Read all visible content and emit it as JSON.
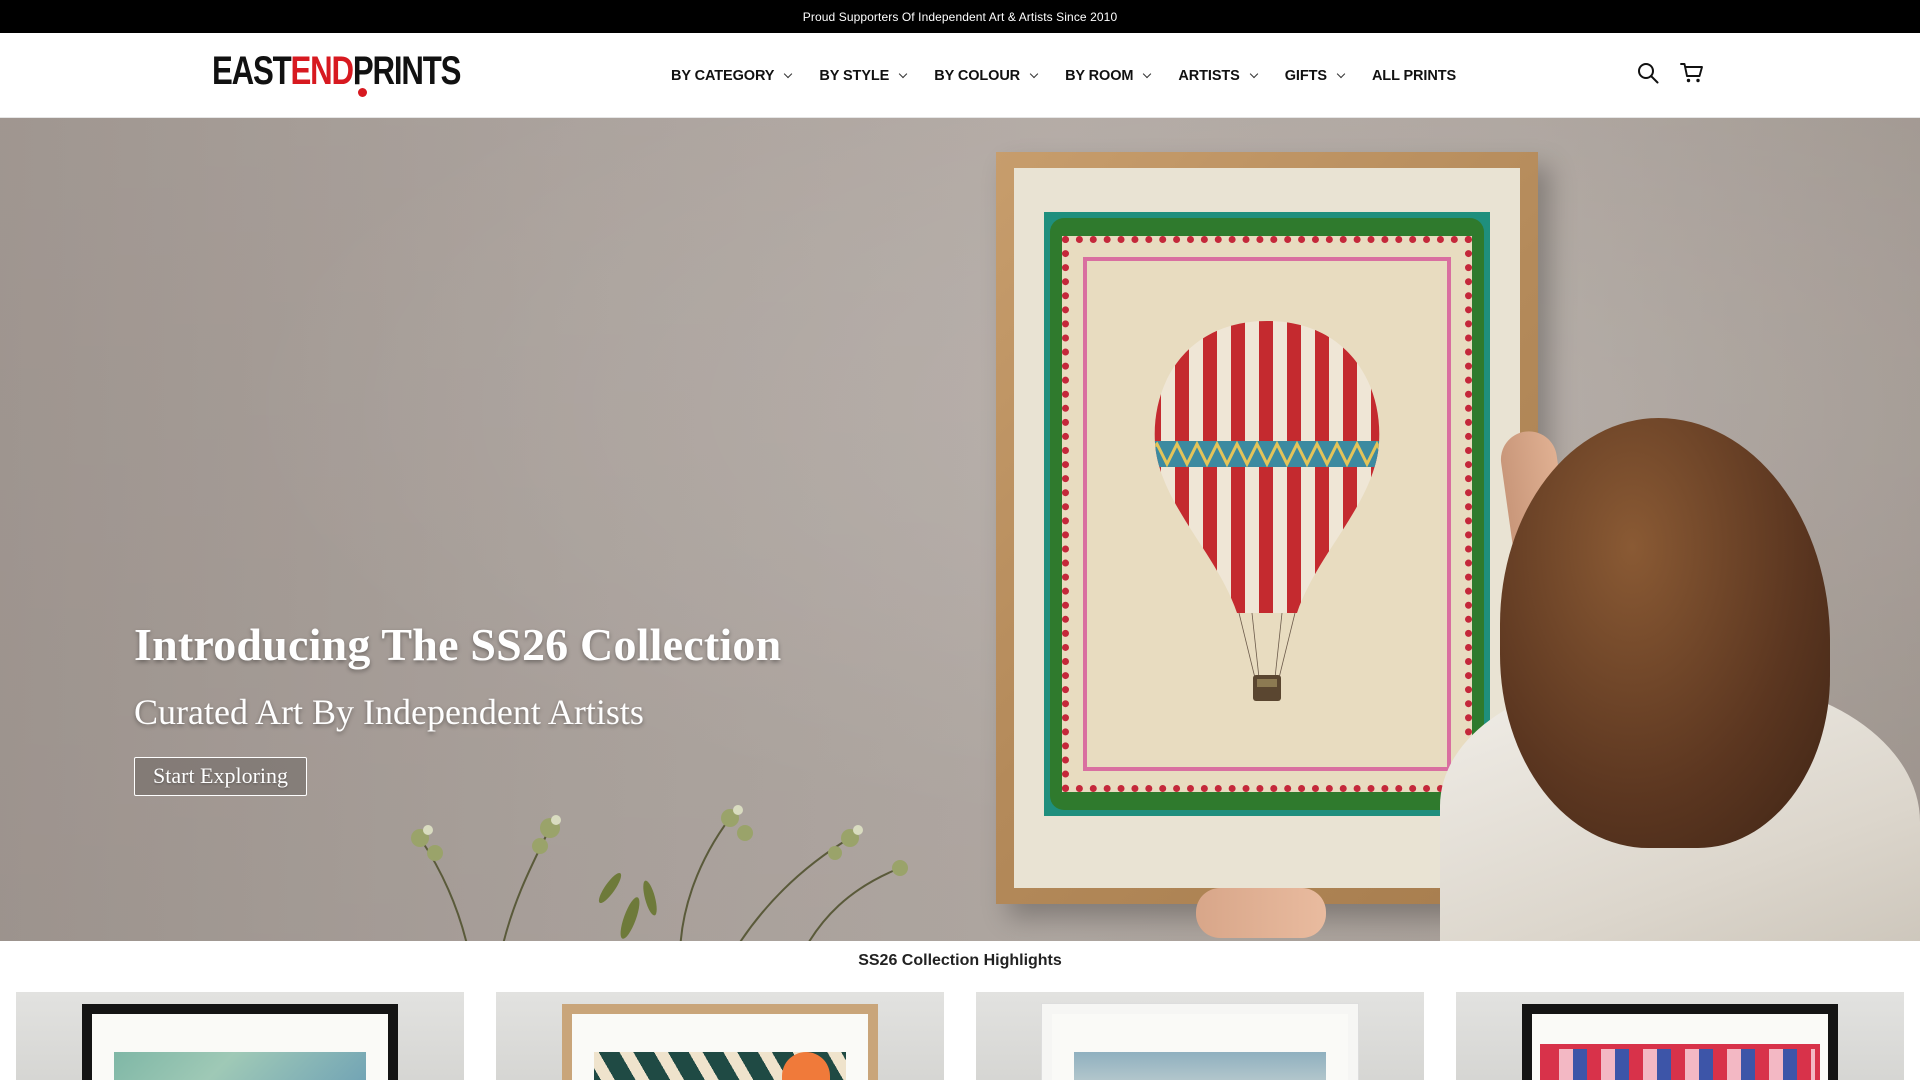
{
  "announcement": "Proud Supporters Of Independent Art & Artists Since 2010",
  "logo": {
    "part1": "EAST",
    "part2": "END",
    "part3": "PRINTS"
  },
  "nav": [
    {
      "label": "BY CATEGORY",
      "dropdown": true
    },
    {
      "label": "BY STYLE",
      "dropdown": true
    },
    {
      "label": "BY COLOUR",
      "dropdown": true
    },
    {
      "label": "BY ROOM",
      "dropdown": true
    },
    {
      "label": "ARTISTS",
      "dropdown": true
    },
    {
      "label": "GIFTS",
      "dropdown": true
    },
    {
      "label": "ALL PRINTS",
      "dropdown": false
    }
  ],
  "header_icons": [
    "search-icon",
    "cart-icon"
  ],
  "hero": {
    "title": "Introducing The SS26 Collection",
    "subtitle": "Curated Art By Independent Artists",
    "cta": "Start Exploring"
  },
  "highlights": {
    "title": "SS26 Collection Highlights"
  },
  "colors": {
    "brand_red": "#d71920",
    "announcement_bg": "#000000"
  }
}
